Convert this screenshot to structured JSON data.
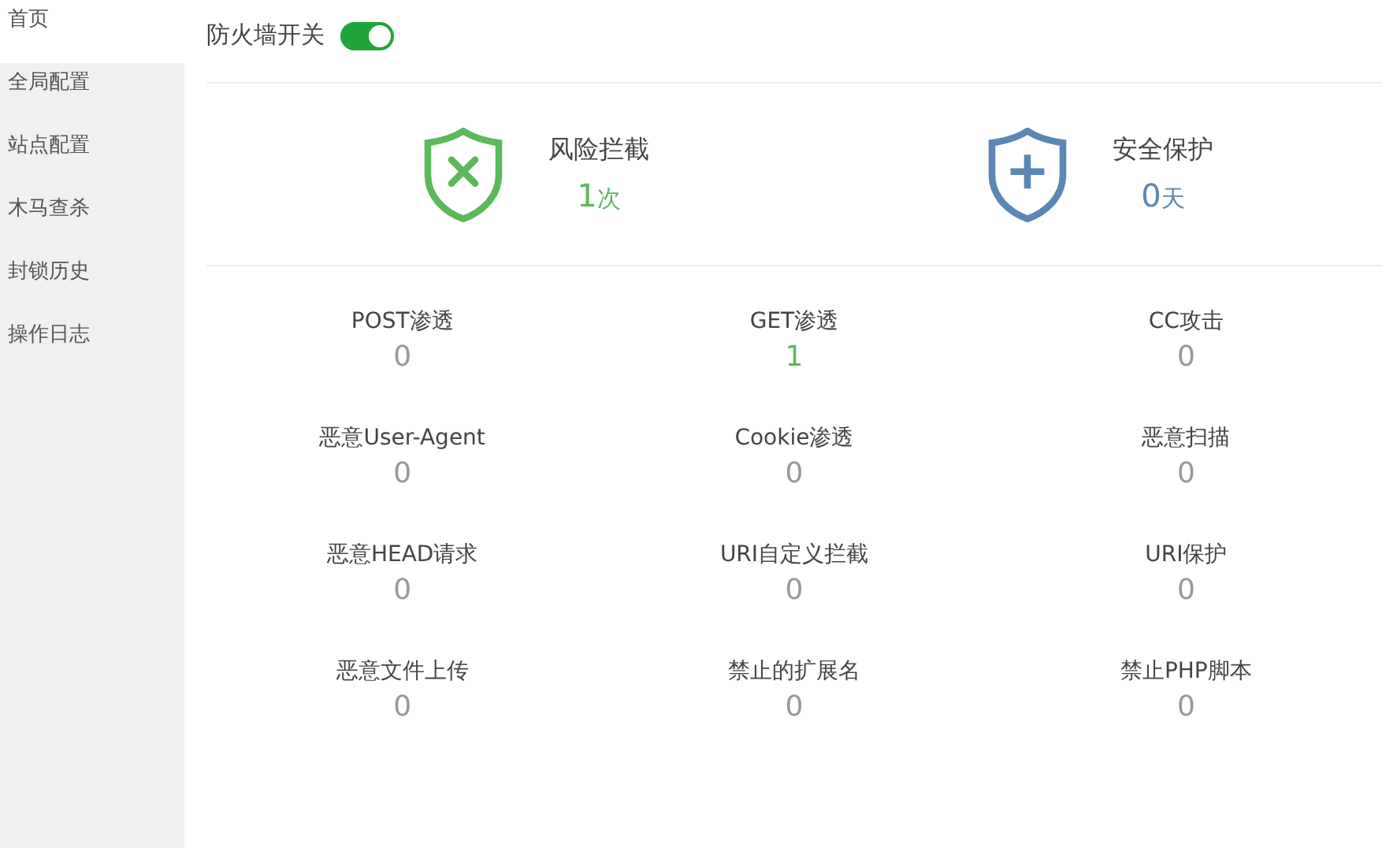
{
  "sidebar": {
    "items": [
      {
        "label": "首页",
        "selected": true
      },
      {
        "label": "全局配置",
        "selected": false
      },
      {
        "label": "站点配置",
        "selected": false
      },
      {
        "label": "木马查杀",
        "selected": false
      },
      {
        "label": "封锁历史",
        "selected": false
      },
      {
        "label": "操作日志",
        "selected": false
      }
    ]
  },
  "firewall_switch": {
    "label": "防火墙开关",
    "on": true
  },
  "summary": [
    {
      "kind": "block",
      "title": "风险拦截",
      "count": "1",
      "unit": "次",
      "color": "#5cb85c"
    },
    {
      "kind": "protect",
      "title": "安全保护",
      "count": "0",
      "unit": "天",
      "color": "#5b87b4"
    }
  ],
  "stats": [
    {
      "label": "POST渗透",
      "value": "0",
      "hit": false
    },
    {
      "label": "GET渗透",
      "value": "1",
      "hit": true
    },
    {
      "label": "CC攻击",
      "value": "0",
      "hit": false
    },
    {
      "label": "恶意User-Agent",
      "value": "0",
      "hit": false
    },
    {
      "label": "Cookie渗透",
      "value": "0",
      "hit": false
    },
    {
      "label": "恶意扫描",
      "value": "0",
      "hit": false
    },
    {
      "label": "恶意HEAD请求",
      "value": "0",
      "hit": false
    },
    {
      "label": "URI自定义拦截",
      "value": "0",
      "hit": false
    },
    {
      "label": "URI保护",
      "value": "0",
      "hit": false
    },
    {
      "label": "恶意文件上传",
      "value": "0",
      "hit": false
    },
    {
      "label": "禁止的扩展名",
      "value": "0",
      "hit": false
    },
    {
      "label": "禁止PHP脚本",
      "value": "0",
      "hit": false
    }
  ]
}
